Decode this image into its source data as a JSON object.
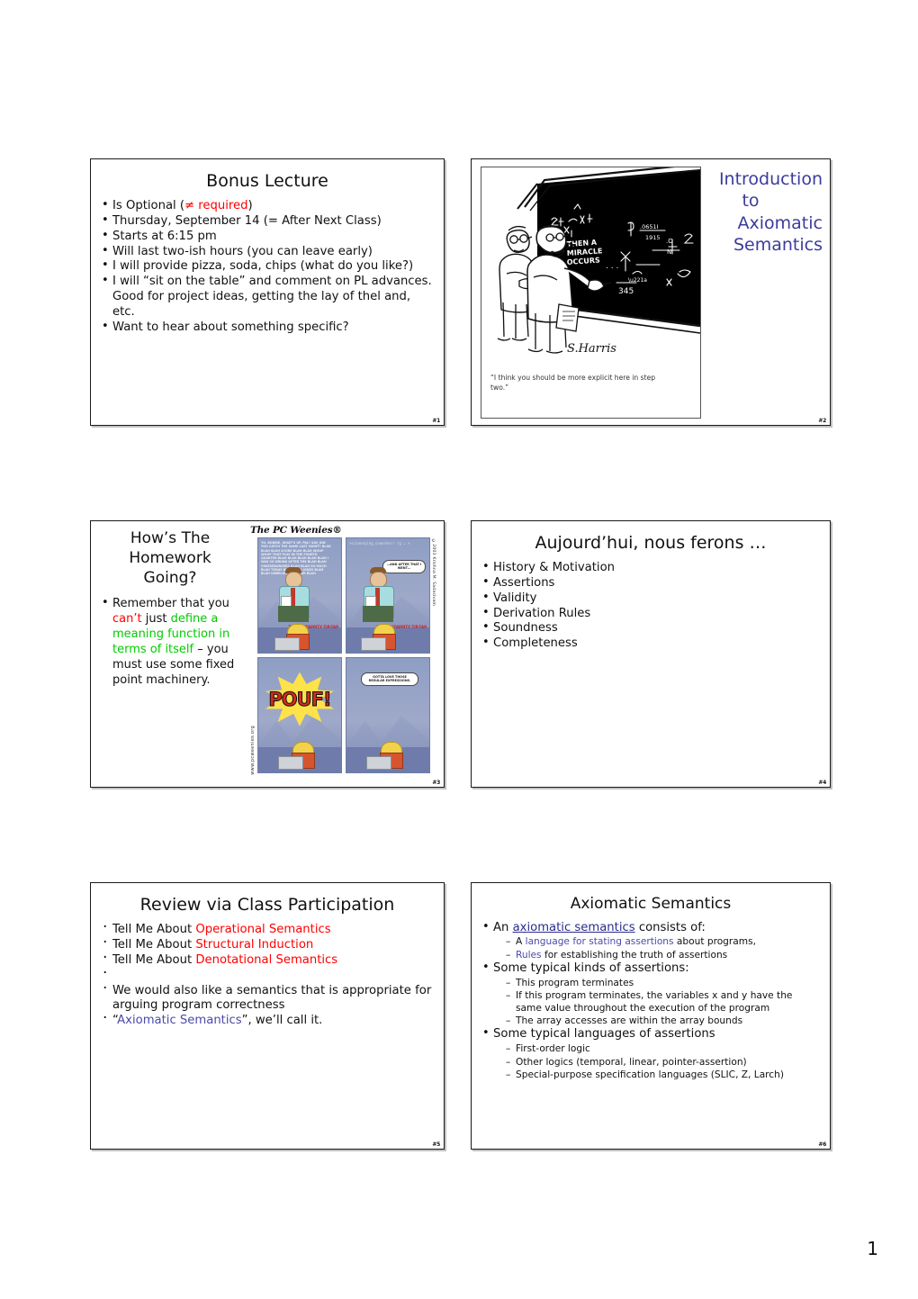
{
  "page": {
    "number": "1"
  },
  "slides": [
    {
      "id": "slide1",
      "number": "#1",
      "title": "Bonus Lecture",
      "bullets": [
        {
          "pre": "Is Optional (",
          "accent": "≠ required",
          "post": ")"
        },
        {
          "pre": "Thursday, September 14 (= After Next Class)"
        },
        {
          "pre": "Starts at 6:15 pm"
        },
        {
          "pre": "Will last two-ish hours (you can leave early)"
        },
        {
          "pre": "I will provide pizza, soda, chips (what do you like?)"
        },
        {
          "pre": "I will “sit on the table” and comment on PL advances. Good for project ideas, getting the lay of thel and, etc."
        },
        {
          "pre": "Want to hear about something specific?"
        }
      ]
    },
    {
      "id": "slide2",
      "number": "#2",
      "title_lines": [
        "Introduction",
        "to",
        "Axiomatic",
        "Semantics"
      ],
      "cartoon": {
        "name": "then-a-miracle-occurs-cartoon",
        "signature": "S.Harris",
        "board_text_1": "THEN A",
        "board_text_2": "MIRACLE",
        "board_text_3": "OCCURS",
        "caption": "“I think you should be more explicit here in step two.”"
      }
    },
    {
      "id": "slide3",
      "number": "#3",
      "title_lines": [
        "How’s The",
        "Homework",
        "Going?"
      ],
      "body": {
        "p1": "Remember that you ",
        "red": "can’t",
        "p2": " just ",
        "green": "define a meaning function in terms of itself",
        "p3": " – you must use some fixed point machinery."
      },
      "comic": {
        "title": "The PC Weenies®",
        "panel1_blah": "YO, BOBBIE, WHAT’S UP, PAL? SAY, DID YOU CATCH THE GAME LAST NIGHT? BLAH BLAH BLAH SCORE BLAH BLAH WOOP WOOP THAT PLAY IN THE FOURTH QUARTER BLAH BLAH BLAH BLAH BLAH I WAS SO DRUNK AFTER THE BLAH BLAH CHEESEBURGERS BLAH BLAH SO MUCH BLAH TODAY BLAH BLAH JONES BLAH BLAH UNBELIEVABLE BLAH BLAH",
        "panel1_tap": "TAPPITY-TAPPITY TIP-TAP",
        "panel2_cmd": ">s/annoying_coworker/ /g ↵ >",
        "panel2_bubble": "…AND AFTER THAT I WENT…",
        "panel2_tap": "TAPPITY-TAPPITY TIP-TAP",
        "panel3_sfx": "POUF!",
        "panel4_bubble": "GOTTA LOVE THOSE REGULAR EXPRESSIONS.",
        "side_left": "www.pcweenies.org",
        "side_right": "©2003 Krishna M. Sadasivam"
      }
    },
    {
      "id": "slide4",
      "number": "#4",
      "title": "Aujourd’hui, nous ferons …",
      "bullets": [
        {
          "text": "History & Motivation",
          "color": "black"
        },
        {
          "text": "Assertions",
          "color": "violet"
        },
        {
          "text": "Validity",
          "color": "black"
        },
        {
          "text": "Derivation Rules",
          "color": "violet"
        },
        {
          "text": "Soundness",
          "color": "black"
        },
        {
          "text": "Completeness",
          "color": "black"
        }
      ]
    },
    {
      "id": "slide5",
      "number": "#5",
      "title": "Review via Class Participation",
      "bullets": [
        {
          "pre": "Tell Me About ",
          "accent": "Operational Semantics",
          "accent_color": "red"
        },
        {
          "pre": "Tell Me About ",
          "accent": "Structural Induction",
          "accent_color": "red"
        },
        {
          "pre": "Tell Me About ",
          "accent": "Denotational Semantics",
          "accent_color": "red"
        },
        {
          "pre": "We would also like a semantics that is appropriate for arguing program correctness"
        },
        {
          "pre": "“",
          "accent": "Axiomatic Semantics",
          "accent_color": "violet",
          "post": "”, we’ll call it."
        }
      ]
    },
    {
      "id": "slide6",
      "number": "#6",
      "title": "Axiomatic Semantics",
      "items": [
        {
          "lead_pre": "An ",
          "lead_link": "axiomatic semantics",
          "lead_post": " consists of:",
          "subs": [
            {
              "pre": "A ",
              "accent": "language for stating assertions",
              "accent_color": "violet",
              "post": " about programs,"
            },
            {
              "accent": "Rules",
              "accent_color": "violet",
              "post": " for establishing the truth of assertions"
            }
          ]
        },
        {
          "lead_pre": "Some typical kinds of assertions:",
          "subs": [
            {
              "pre": "This program terminates"
            },
            {
              "pre": "If this program terminates, the variables x and y have the same value throughout the execution of the program"
            },
            {
              "pre": "The array accesses are within the array bounds"
            }
          ]
        },
        {
          "lead_pre": "Some typical languages of assertions",
          "subs": [
            {
              "accent": "First-order logic",
              "accent_color": "green"
            },
            {
              "pre": "Other logics (temporal, linear, pointer-assertion)"
            },
            {
              "pre": "Special-purpose specification languages (SLIC, Z, Larch)"
            }
          ]
        }
      ]
    }
  ],
  "colors": {
    "red": "#ff0000",
    "green": "#00cc00",
    "blue": "#3b3b9e",
    "violet": "#4a4aaa",
    "navy": "#2b2b8c",
    "text": "#111111"
  }
}
